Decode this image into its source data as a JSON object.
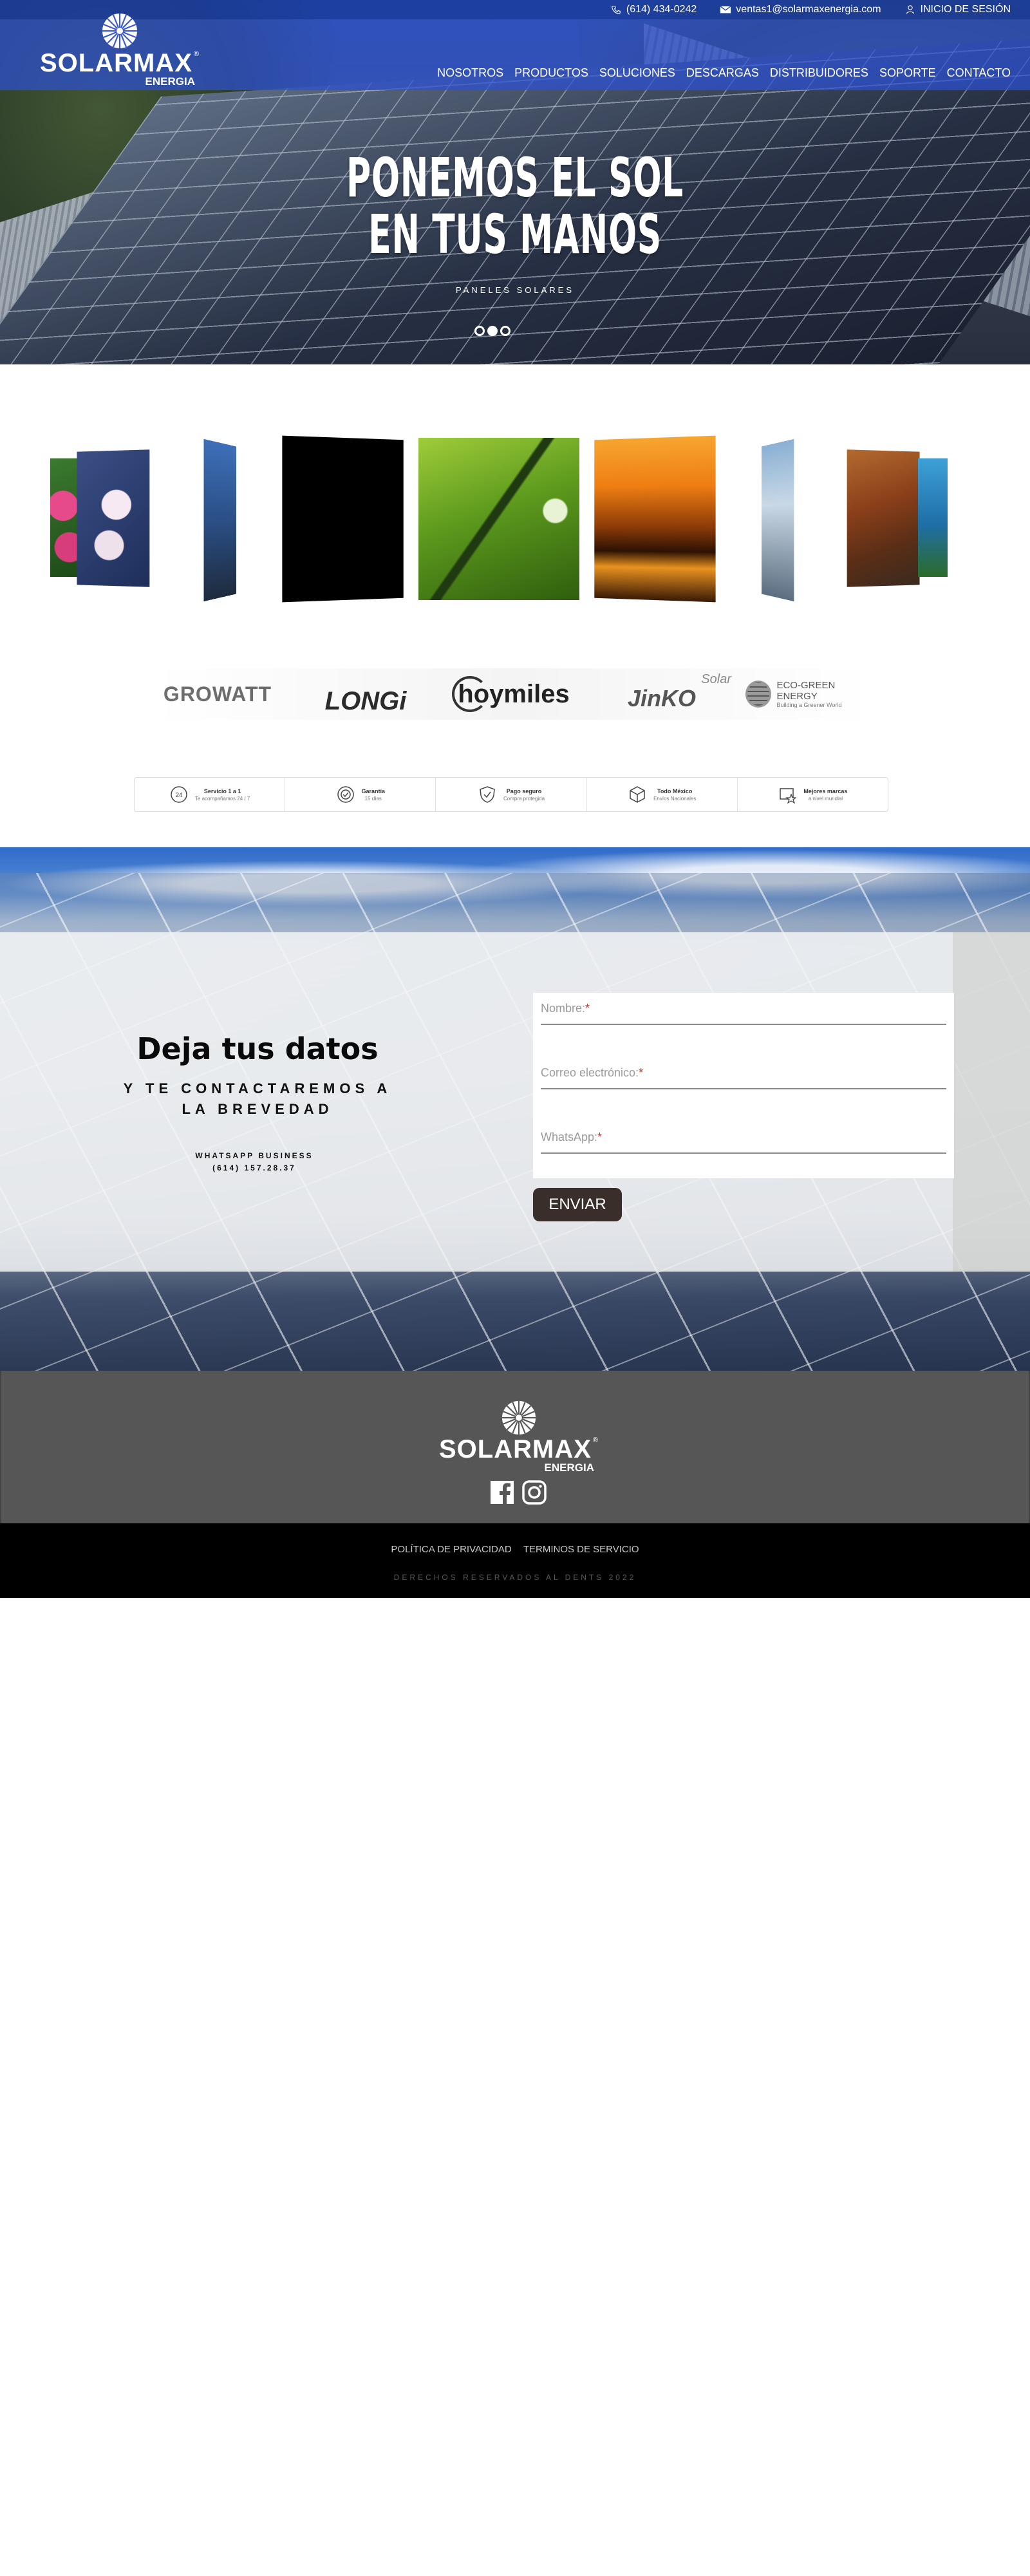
{
  "topbar": {
    "phone": "(614) 434-0242",
    "email": "ventas1@solarmaxenergia.com",
    "login": "INICIO DE SESIÓN"
  },
  "brand": {
    "name": "SOLARMAX",
    "sub": "ENERGIA",
    "registered": "®"
  },
  "nav": {
    "items": [
      "NOSOTROS",
      "PRODUCTOS",
      "SOLUCIONES",
      "DESCARGAS",
      "DISTRIBUIDORES",
      "SOPORTE",
      "CONTACTO"
    ]
  },
  "hero": {
    "title_line1": "PONEMOS EL SOL",
    "title_line2": "EN TUS MANOS",
    "subtitle": "PANELES SOLARES",
    "slides": 3,
    "active_slide": 2
  },
  "gallery": {
    "images": [
      "orchid-photo",
      "flowers-photo",
      "tree-photo",
      "black-photo",
      "grass-photo",
      "sunset-photo",
      "cliff-photo",
      "autumn-photo",
      "lake-photo"
    ]
  },
  "brands": {
    "items": [
      "GROWATT",
      "LONGi",
      "hoymiles",
      "JinKO",
      "ECO-GREEN ENERGY"
    ],
    "jinko_tag": "Solar",
    "eco_tagline": "Building a Greener World"
  },
  "features": [
    {
      "icon": "support-24h-icon",
      "title": "Servicio 1 a 1",
      "subtitle": "Te acompañamos 24 / 7"
    },
    {
      "icon": "warranty-icon",
      "title": "Garantía",
      "subtitle": "15 días"
    },
    {
      "icon": "shield-icon",
      "title": "Pago seguro",
      "subtitle": "Compra protegida"
    },
    {
      "icon": "box-icon",
      "title": "Todo México",
      "subtitle": "Envíos Nacionales"
    },
    {
      "icon": "star-card-icon",
      "title": "Mejores marcas",
      "subtitle": "a nivel mundial"
    }
  ],
  "contact": {
    "title": "Deja tus datos",
    "subtitle": "Y TE CONTACTAREMOS A LA BREVEDAD",
    "whatsapp_label": "WHATSAPP BUSINESS",
    "whatsapp_number": "(614) 157.28.37",
    "fields": [
      {
        "label": "Nombre:",
        "required": "*"
      },
      {
        "label": "Correo electrónico:",
        "required": "*"
      },
      {
        "label": "WhatsApp:",
        "required": "*"
      }
    ],
    "submit": "ENVIAR"
  },
  "footer": {
    "privacy": "POLÍTICA DE PRIVACIDAD",
    "terms": "TERMINOS DE SERVICIO",
    "rights": "DERECHOS RESERVADOS AL DENTS 2022",
    "social": [
      "facebook-icon",
      "instagram-icon"
    ]
  },
  "colors": {
    "topbar": "#1e3fb0",
    "navbar": "#2d50d2",
    "button": "#3a2e2a",
    "footer": "#565656",
    "bottom": "#000000",
    "required": "#d0342c"
  }
}
